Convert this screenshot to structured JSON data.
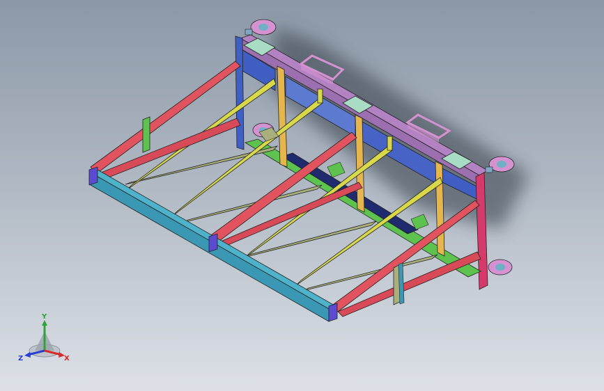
{
  "scene": {
    "background_top": "#8c98a7",
    "background_bottom": "#dde1e7",
    "model": "rack-frame-assembly"
  },
  "colors": {
    "red": "#e0535f",
    "teal": "#3a98b4",
    "yellow": "#d8d84a",
    "olive": "#a9b07e",
    "blue": "#3f5fc4",
    "purple": "#b382c2",
    "magenta": "#d43a6a",
    "green": "#5ec24e",
    "navy": "#1f2b6e",
    "mint": "#a9dcc5",
    "pink": "#d493d0",
    "orange": "#e6b64e"
  },
  "triad": {
    "x_label": "X",
    "y_label": "Y",
    "z_label": "Z",
    "x_color": "#d62c2c",
    "y_color": "#2fa23a",
    "z_color": "#2a3fd1"
  }
}
